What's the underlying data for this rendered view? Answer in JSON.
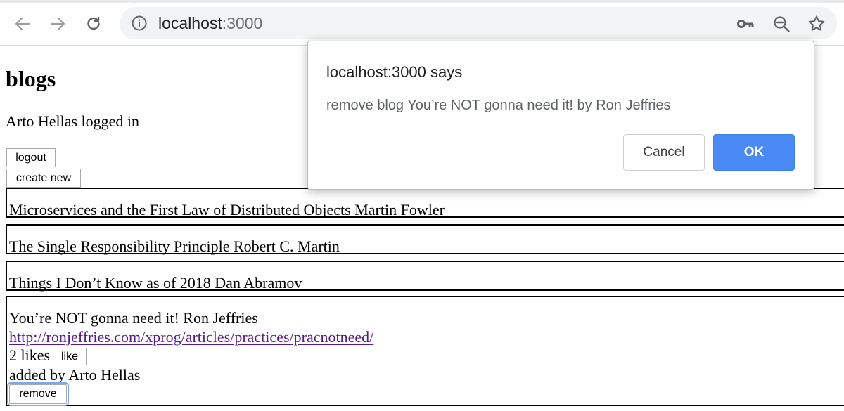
{
  "browser": {
    "url_host": "localhost",
    "url_port": ":3000",
    "icons": [
      "back-arrow-icon",
      "forward-arrow-icon",
      "reload-icon",
      "info-icon",
      "key-icon",
      "zoom-icon",
      "star-icon"
    ]
  },
  "page": {
    "title": "blogs",
    "login_status": "Arto Hellas logged in",
    "logout_label": "logout",
    "create_new_label": "create new"
  },
  "blogs": [
    {
      "summary": "Microservices and the First Law of Distributed Objects Martin Fowler"
    },
    {
      "summary": "The Single Responsibility Principle Robert C. Martin"
    },
    {
      "summary": "Things I Don’t Know as of 2018 Dan Abramov"
    },
    {
      "summary": "You’re NOT gonna need it! Ron Jeffries",
      "url": "http://ronjeffries.com/xprog/articles/practices/pracnotneed/",
      "likes": "2 likes",
      "like_label": "like",
      "added_by": "added by Arto Hellas",
      "remove_label": "remove"
    }
  ],
  "dialog": {
    "title": "localhost:3000 says",
    "message": "remove blog You’re NOT gonna need it! by Ron Jeffries",
    "cancel_label": "Cancel",
    "ok_label": "OK"
  },
  "colors": {
    "link": "#551a8b",
    "ok_button": "#4a8af4",
    "focus_ring": "#7ba9f0"
  }
}
